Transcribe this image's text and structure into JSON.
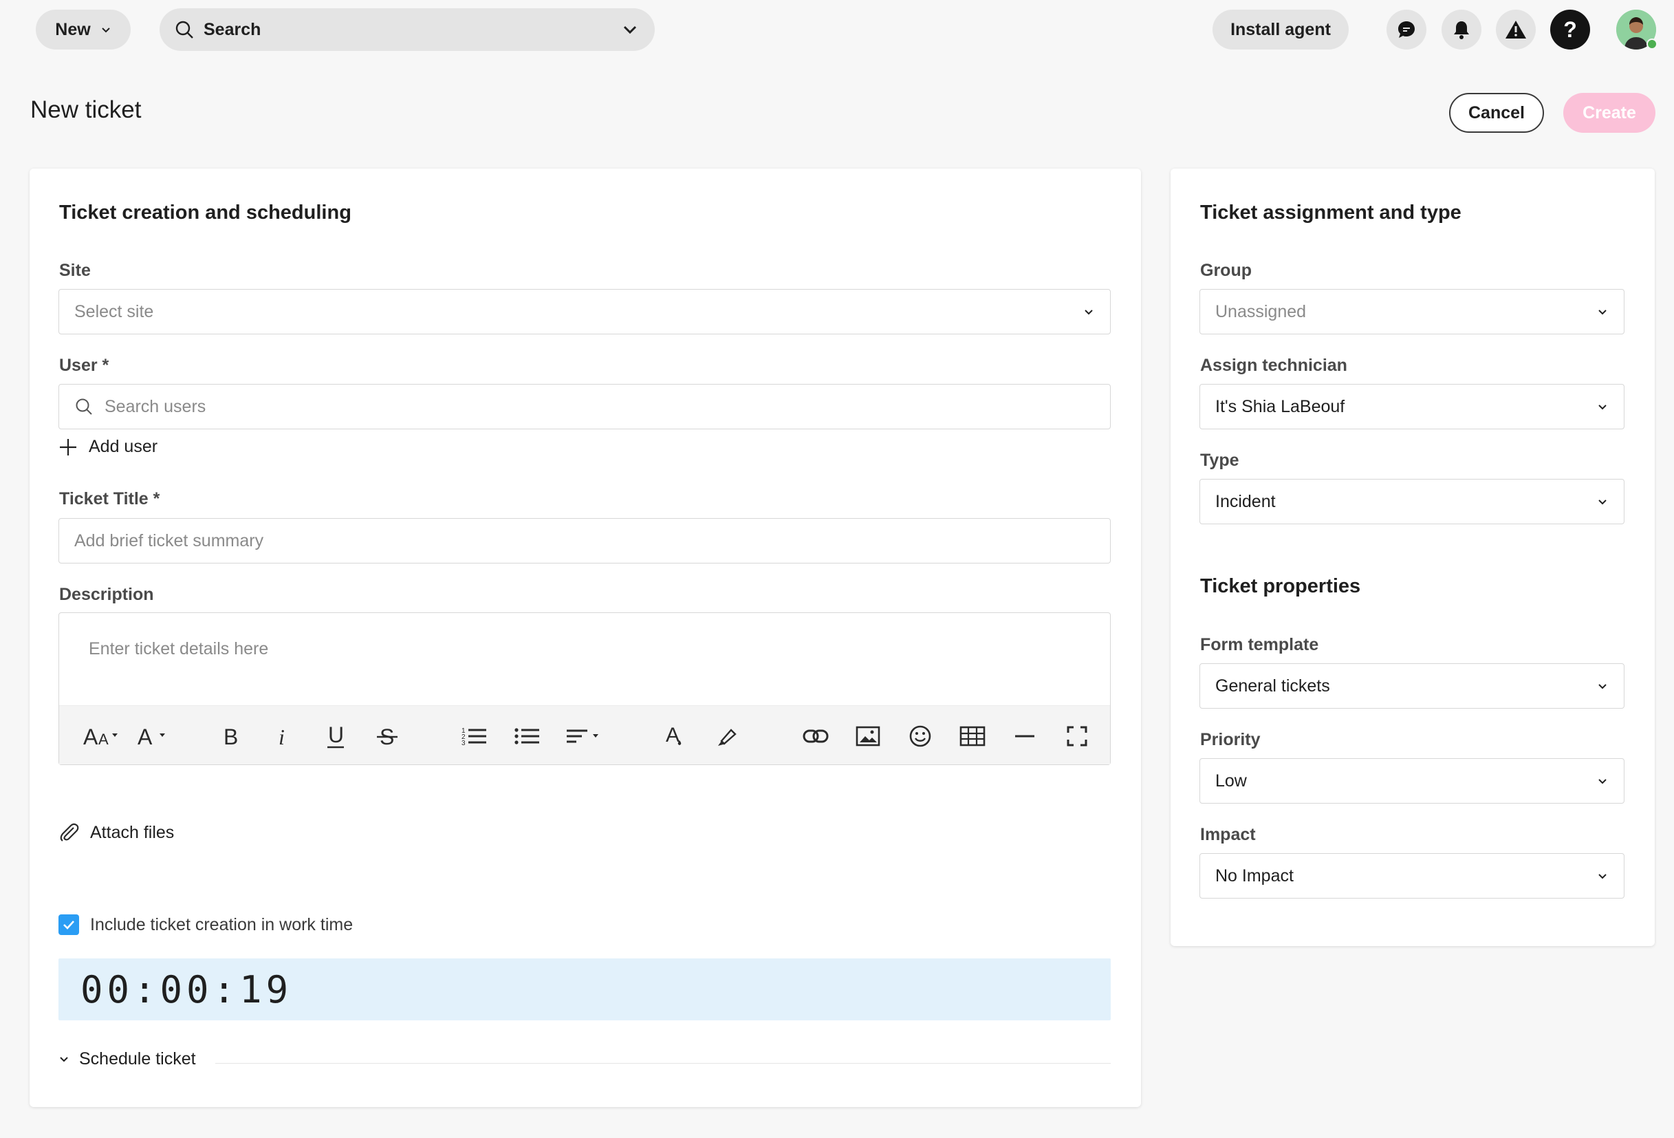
{
  "topbar": {
    "new_label": "New",
    "search_label": "Search",
    "install_label": "Install agent",
    "help_symbol": "?"
  },
  "page": {
    "title": "New ticket",
    "cancel_label": "Cancel",
    "create_label": "Create"
  },
  "left_card": {
    "heading": "Ticket creation and scheduling",
    "site": {
      "label": "Site",
      "placeholder": "Select site"
    },
    "user": {
      "label": "User *",
      "placeholder": "Search users",
      "add_label": "Add user"
    },
    "title": {
      "label": "Ticket Title *",
      "placeholder": "Add brief ticket summary"
    },
    "description": {
      "label": "Description",
      "placeholder": "Enter ticket details here"
    },
    "attach_label": "Attach files",
    "worktime_label": "Include ticket creation in work time",
    "worktime_checked": true,
    "timer": "00:00:19",
    "schedule_label": "Schedule ticket"
  },
  "right_card": {
    "heading": "Ticket assignment and type",
    "group": {
      "label": "Group",
      "placeholder": "Unassigned"
    },
    "technician": {
      "label": "Assign technician",
      "value": "It's Shia LaBeouf"
    },
    "type": {
      "label": "Type",
      "value": "Incident"
    },
    "properties_heading": "Ticket properties",
    "form_template": {
      "label": "Form template",
      "value": "General tickets"
    },
    "priority": {
      "label": "Priority",
      "value": "Low"
    },
    "impact": {
      "label": "Impact",
      "value": "No Impact"
    }
  },
  "colors": {
    "accent_pink": "#fbc1d8",
    "checkbox_blue": "#2a9df4",
    "timer_bg": "#e2f1fb"
  }
}
